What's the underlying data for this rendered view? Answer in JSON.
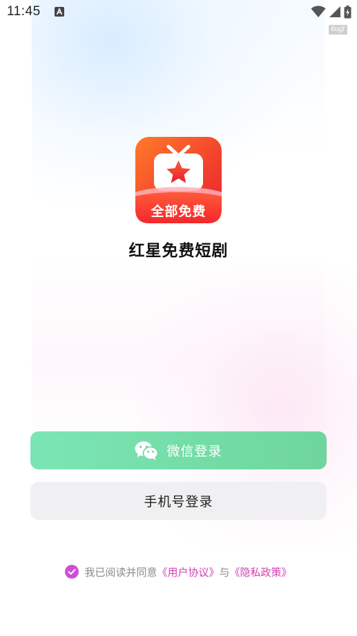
{
  "status_bar": {
    "time": "11:45",
    "build_tag": "6ugf",
    "icons": [
      "notification-a-icon",
      "wifi-icon",
      "cellular-signal-icon",
      "battery-charging-icon"
    ]
  },
  "app": {
    "logo_icon": "tv-star-logo-icon",
    "logo_text": "全部免费",
    "name": "红星免费短剧"
  },
  "login": {
    "wechat_label": "微信登录",
    "wechat_icon": "wechat-icon",
    "phone_label": "手机号登录"
  },
  "agreement": {
    "checked": true,
    "prefix": "我已阅读并同意",
    "user_agreement": "《用户协议》",
    "conjunction": "与",
    "privacy_policy": "《隐私政策》"
  },
  "colors": {
    "wechat_gradient_start": "#7be5b5",
    "wechat_gradient_end": "#6ed69c",
    "phone_button_bg": "#f0f0f2",
    "link": "#d13fb1",
    "checkbox": "#cf4fd6",
    "logo_red": "#f23a2c",
    "logo_orange": "#ff7a2a"
  }
}
